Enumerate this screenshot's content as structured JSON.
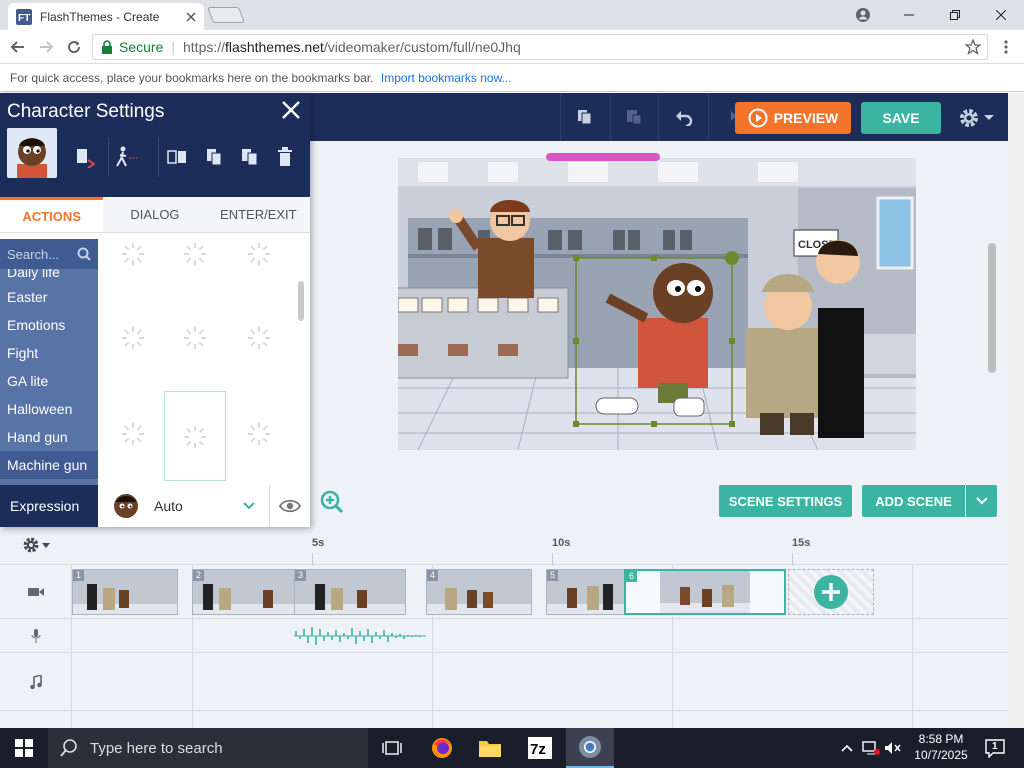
{
  "browser": {
    "tab_title": "FlashThemes - Create",
    "url_scheme": "https://",
    "url_host": "flashthemes.net",
    "url_path": "/videomaker/custom/full/ne0Jhq",
    "secure_label": "Secure",
    "bookmarks_text": "For quick access, place your bookmarks here on the bookmarks bar.",
    "bookmarks_link": "Import bookmarks now..."
  },
  "toolbar": {
    "preview_label": "PREVIEW",
    "save_label": "SAVE"
  },
  "character_panel": {
    "title": "Character Settings",
    "tabs": [
      "ACTIONS",
      "DIALOG",
      "ENTER/EXIT"
    ],
    "active_tab": "ACTIONS",
    "search_placeholder": "Search...",
    "categories": [
      "Daily life",
      "Easter",
      "Emotions",
      "Fight",
      "GA lite",
      "Halloween",
      "Hand gun",
      "Machine gun"
    ],
    "selected_category": "Machine gun",
    "expression_label": "Expression",
    "expression_value": "Auto"
  },
  "stage": {
    "sign_text": "CLOSED",
    "progress_fraction": 0.5
  },
  "scene_buttons": {
    "scene_settings": "SCENE SETTINGS",
    "add_scene": "ADD SCENE"
  },
  "timeline": {
    "ticks": [
      "5s",
      "10s",
      "15s"
    ],
    "scenes": [
      {
        "num": "1"
      },
      {
        "num": "2"
      },
      {
        "num": "3"
      },
      {
        "num": "4"
      },
      {
        "num": "5"
      },
      {
        "num": "6"
      }
    ],
    "selected_scene": "6"
  },
  "taskbar": {
    "search_placeholder": "Type here to search",
    "time": "8:58 PM",
    "date": "10/7/2025",
    "notification_count": "1"
  },
  "colors": {
    "navy": "#1d2d5a",
    "teal": "#3bb4a2",
    "orange": "#f2742b",
    "category_blue": "#5873a6",
    "progress_pink": "#d657c4"
  }
}
